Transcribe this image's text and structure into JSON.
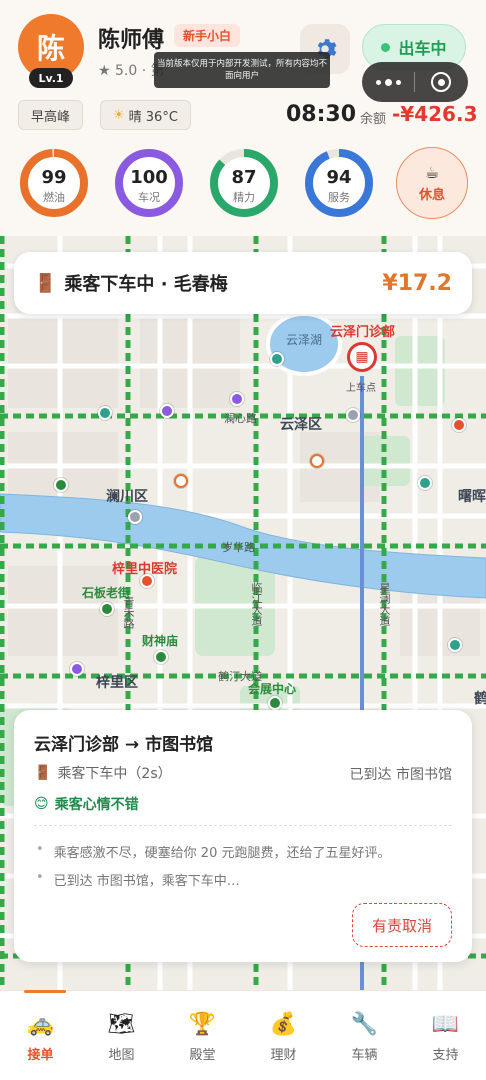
{
  "driver": {
    "avatar_char": "陈",
    "level": "Lv.1",
    "name": "陈师傅",
    "badge": "新手小白",
    "rating": "★ 5.0 · 第"
  },
  "status_button": "出车中",
  "dev_notice": "当前版本仅用于内部开发测试，所有内容均不面向用户",
  "chips": {
    "traffic": "早高峰",
    "weather_icon": "sun-icon",
    "weather": "晴 36°C"
  },
  "clock": "08:30",
  "balance": {
    "label": "余额",
    "value": "-¥426.3"
  },
  "gauges": [
    {
      "value": "99",
      "label": "燃油",
      "percent": 99,
      "color": "#e8722c"
    },
    {
      "value": "100",
      "label": "车况",
      "percent": 100,
      "color": "#8a5ae0"
    },
    {
      "value": "87",
      "label": "精力",
      "percent": 87,
      "color": "#2aa76a"
    },
    {
      "value": "94",
      "label": "服务",
      "percent": 94,
      "color": "#3a78d8"
    }
  ],
  "rest_button": {
    "icon": "coffee-icon",
    "label": "休息"
  },
  "drop_card": {
    "icon": "door-icon",
    "text": "乘客下车中 · 毛春梅",
    "fare": "¥17.2"
  },
  "map": {
    "districts": [
      "云泽区",
      "澜川区",
      "梓里区",
      "曙晖"
    ],
    "roads": [
      "澜心路",
      "岁华路",
      "青禾路",
      "临江大道",
      "鹤汀大道",
      "星澜大道"
    ],
    "pois": [
      "石板老街",
      "财神庙",
      "会展中心"
    ],
    "hospital": "梓里中医院",
    "lake": "云泽湖",
    "clinic": "云泽门诊部",
    "pickup": "上车点",
    "edge_label": "鹤"
  },
  "trip": {
    "route": "云泽门诊部 → 市图书馆",
    "status": "乘客下车中（2s）",
    "arrived": "已到达 市图书馆",
    "mood": "乘客心情不错",
    "logs": [
      "乘客感激不尽，硬塞给你 20 元跑腿费，还给了五星好评。",
      "已到达 市图书馆，乘客下车中…"
    ],
    "cancel_button": "有责取消"
  },
  "nav": [
    {
      "icon": "taxi-icon",
      "glyph": "🚕",
      "label": "接单",
      "active": true
    },
    {
      "icon": "map-icon",
      "glyph": "🗺",
      "label": "地图",
      "active": false
    },
    {
      "icon": "trophy-icon",
      "glyph": "🏆",
      "label": "殿堂",
      "active": false
    },
    {
      "icon": "money-bag-icon",
      "glyph": "💰",
      "label": "理财",
      "active": false
    },
    {
      "icon": "wrench-icon",
      "glyph": "🔧",
      "label": "车辆",
      "active": false
    },
    {
      "icon": "book-icon",
      "glyph": "📖",
      "label": "支持",
      "active": false
    }
  ],
  "colors": {
    "brand_orange": "#ef7a2b",
    "online_green": "#1f9d55",
    "balance_red": "#e5382f",
    "road_green": "#35a84a",
    "river_blue": "#8fc3e8"
  }
}
